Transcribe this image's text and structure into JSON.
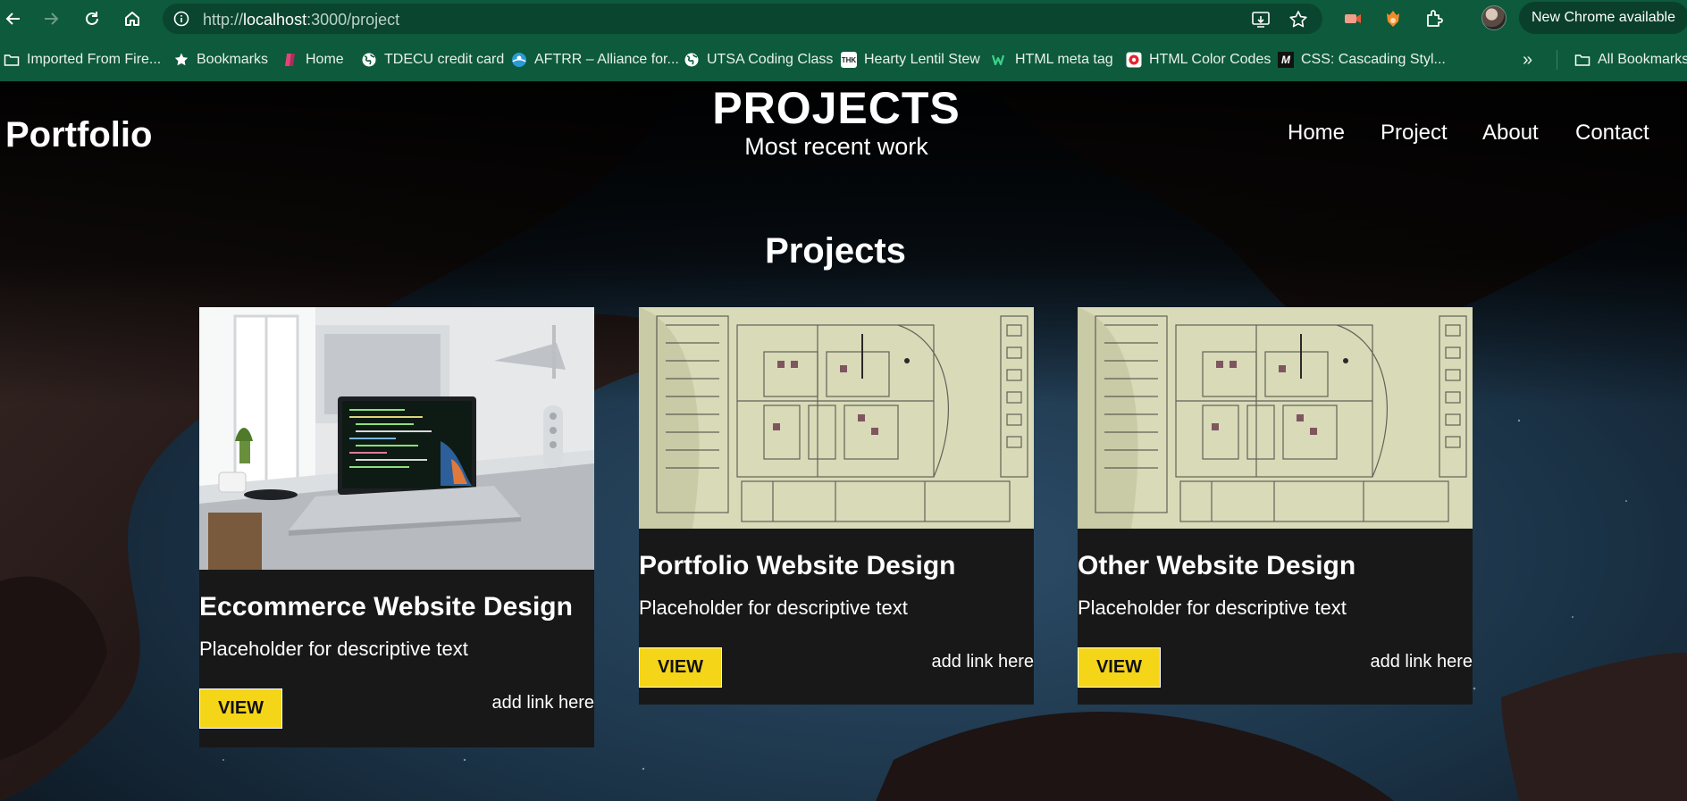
{
  "browser": {
    "url_prefix": "http://",
    "url_host": "localhost",
    "url_rest": ":3000/project",
    "update_label": "New Chrome available",
    "update_menu": "⋮",
    "overflow_label": "»",
    "bookmarks": [
      {
        "label": "Imported From Fire...",
        "icon": "folder-icon"
      },
      {
        "label": "Bookmarks",
        "icon": "star-icon"
      },
      {
        "label": "Home",
        "icon": "home-bookmark-icon"
      },
      {
        "label": "TDECU credit card",
        "icon": "globe-icon"
      },
      {
        "label": "AFTRR – Alliance for...",
        "icon": "aftrr-icon"
      },
      {
        "label": "UTSA Coding Class",
        "icon": "globe-icon"
      },
      {
        "label": "Hearty Lentil Stew",
        "icon": "thk-icon"
      },
      {
        "label": "HTML meta tag",
        "icon": "w-icon"
      },
      {
        "label": "HTML Color Codes",
        "icon": "color-codes-icon"
      },
      {
        "label": "CSS: Cascading Styl...",
        "icon": "mdn-icon"
      }
    ],
    "all_bookmarks": "All Bookmarks",
    "thk_badge": "THK",
    "mdn_badge": "M"
  },
  "site": {
    "brand": "Portfolio",
    "hero_title": "PROJECTS",
    "hero_subtitle": "Most recent work",
    "nav": [
      "Home",
      "Project",
      "About",
      "Contact"
    ],
    "section_title": "Projects"
  },
  "projects": [
    {
      "title": "Eccommerce Website Design",
      "description": "Placeholder for descriptive text",
      "button": "VIEW",
      "link": "add link here",
      "image": "laptop-desk"
    },
    {
      "title": "Portfolio Website Design",
      "description": "Placeholder for descriptive text",
      "button": "VIEW",
      "link": "add link here",
      "image": "blueprint"
    },
    {
      "title": "Other Website Design",
      "description": "Placeholder for descriptive text",
      "button": "VIEW",
      "link": "add link here",
      "image": "blueprint"
    }
  ],
  "colors": {
    "chrome_bg": "#0d5a3c",
    "button_yellow": "#f5d518",
    "card_bg": "#181818"
  }
}
